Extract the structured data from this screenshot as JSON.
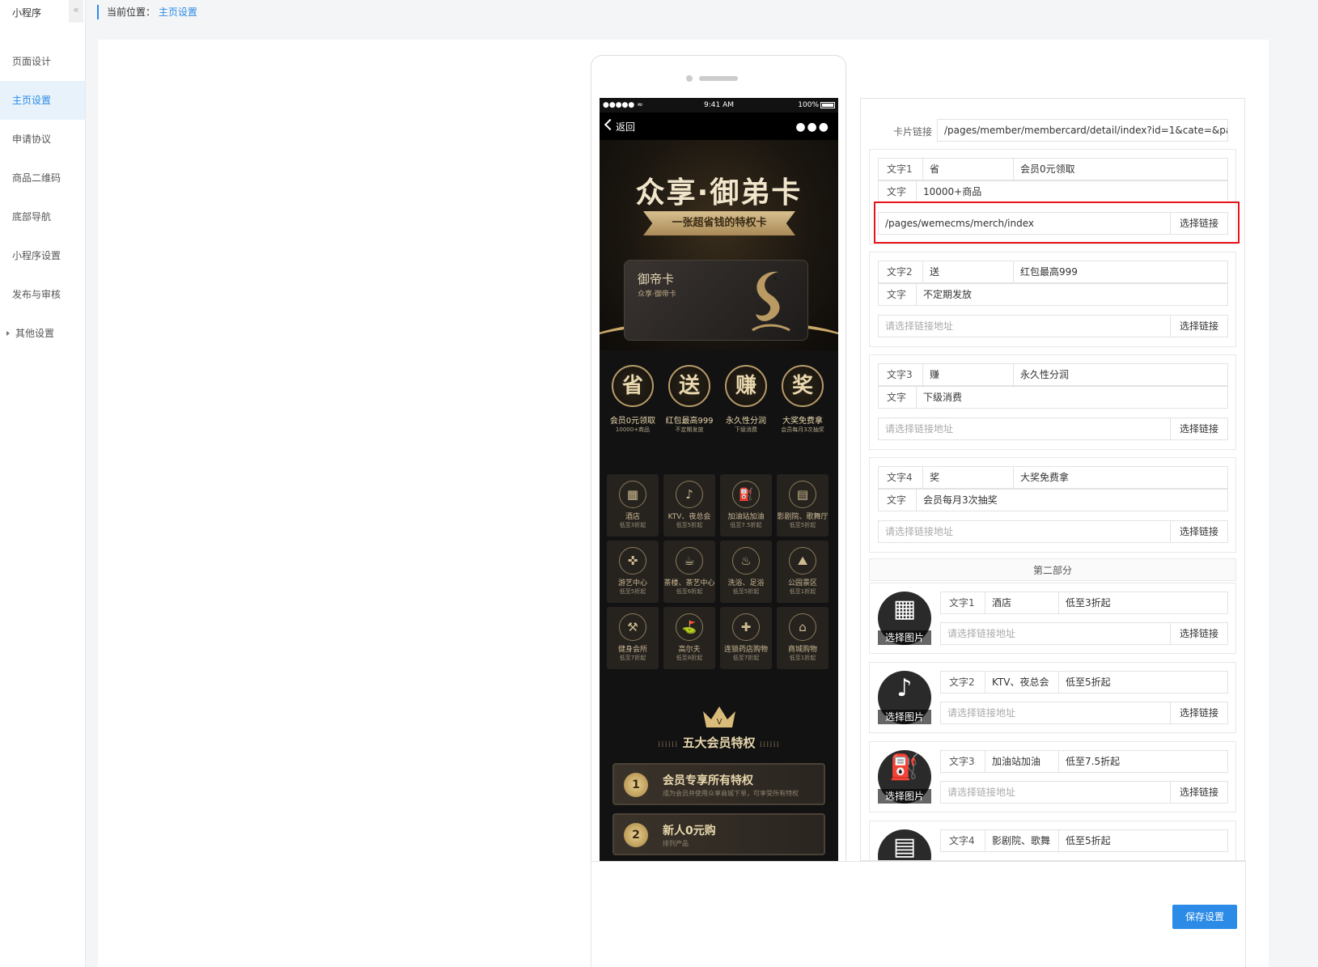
{
  "sidebar": {
    "title": "小程序",
    "collapse_icon": "«",
    "items": [
      {
        "label": "页面设计"
      },
      {
        "label": "主页设置"
      },
      {
        "label": "申请协议"
      },
      {
        "label": "商品二维码"
      },
      {
        "label": "底部导航"
      },
      {
        "label": "小程序设置"
      },
      {
        "label": "发布与审核"
      },
      {
        "label": "其他设置"
      }
    ]
  },
  "breadcrumb": {
    "prefix": "当前位置：",
    "current": "主页设置"
  },
  "phone": {
    "status": {
      "signal": "●●●●● ≈",
      "time": "9:41 AM",
      "battery": "100%"
    },
    "nav": {
      "back_label": "返回",
      "more": "●●●"
    },
    "hero": {
      "title": "众享·御弟卡",
      "ribbon": "一张超省钱的特权卡",
      "card_name": "御帝卡",
      "card_sub": "众享·御帝卡"
    },
    "circles": [
      {
        "char": "省",
        "main": "会员0元领取",
        "sub": "10000+商品"
      },
      {
        "char": "送",
        "main": "红包最高999",
        "sub": "不定期发放"
      },
      {
        "char": "赚",
        "main": "永久性分润",
        "sub": "下级消费"
      },
      {
        "char": "奖",
        "main": "大奖免费拿",
        "sub": "会员每月3次抽奖"
      }
    ],
    "tiles": [
      {
        "glyph": "▦",
        "name": "酒店",
        "sub": "低至3折起"
      },
      {
        "glyph": "♪",
        "name": "KTV、夜总会",
        "sub": "低至5折起"
      },
      {
        "glyph": "⛽",
        "name": "加油站加油",
        "sub": "低至7.5折起"
      },
      {
        "glyph": "▤",
        "name": "影剧院、歌舞厅",
        "sub": "低至5折起"
      },
      {
        "glyph": "✜",
        "name": "游艺中心",
        "sub": "低至5折起"
      },
      {
        "glyph": "☕",
        "name": "茶楼、茶艺中心",
        "sub": "低至6折起"
      },
      {
        "glyph": "♨",
        "name": "洗浴、足浴",
        "sub": "低至5折起"
      },
      {
        "glyph": "⛰",
        "name": "公园景区",
        "sub": "低至1折起"
      },
      {
        "glyph": "⚒",
        "name": "健身会所",
        "sub": "低至7折起"
      },
      {
        "glyph": "⛳",
        "name": "高尔夫",
        "sub": "低至8折起"
      },
      {
        "glyph": "✚",
        "name": "连锁药店购物",
        "sub": "低至7折起"
      },
      {
        "glyph": "⌂",
        "name": "商城购物",
        "sub": "低至1折起"
      }
    ],
    "privilege": {
      "dots": "⁞⁞⁞⁞⁞⁞",
      "title": "五大会员特权"
    },
    "benefits": [
      {
        "num": "1",
        "title": "会员专享所有特权",
        "sub": "成为会员并使用众享商城下单，可享受所有特权"
      },
      {
        "num": "2",
        "title": "新人0元购",
        "sub": "排列产品"
      }
    ]
  },
  "form": {
    "card_link_label": "卡片链接",
    "card_link_value": "/pages/member/membercard/detail/index?id=1&cate=&page",
    "link_button": "选择链接",
    "link_placeholder": "请选择链接地址",
    "text_label": "文字",
    "items": [
      {
        "label": "文字1",
        "char": "省",
        "title": "会员0元领取",
        "desc": "10000+商品",
        "link": "/pages/wemecms/merch/index"
      },
      {
        "label": "文字2",
        "char": "送",
        "title": "红包最高999",
        "desc": "不定期发放",
        "link": ""
      },
      {
        "label": "文字3",
        "char": "赚",
        "title": "永久性分润",
        "desc": "下级消费",
        "link": ""
      },
      {
        "label": "文字4",
        "char": "奖",
        "title": "大奖免费拿",
        "desc": "会员每月3次抽奖",
        "link": ""
      }
    ],
    "section2_title": "第二部分",
    "choose_image": "选择图片",
    "part2": [
      {
        "label": "文字1",
        "name": "酒店",
        "discount": "低至3折起",
        "glyph": "▦"
      },
      {
        "label": "文字2",
        "name": "KTV、夜总会",
        "discount": "低至5折起",
        "glyph": "♪"
      },
      {
        "label": "文字3",
        "name": "加油站加油",
        "discount": "低至7.5折起",
        "glyph": "⛽"
      },
      {
        "label": "文字4",
        "name": "影剧院、歌舞",
        "discount": "低至5折起",
        "glyph": "▤"
      }
    ]
  },
  "save_button": "保存设置",
  "colors": {
    "accent": "#2b8be6",
    "highlight": "#e6141a",
    "gold": "#c9a96a"
  }
}
